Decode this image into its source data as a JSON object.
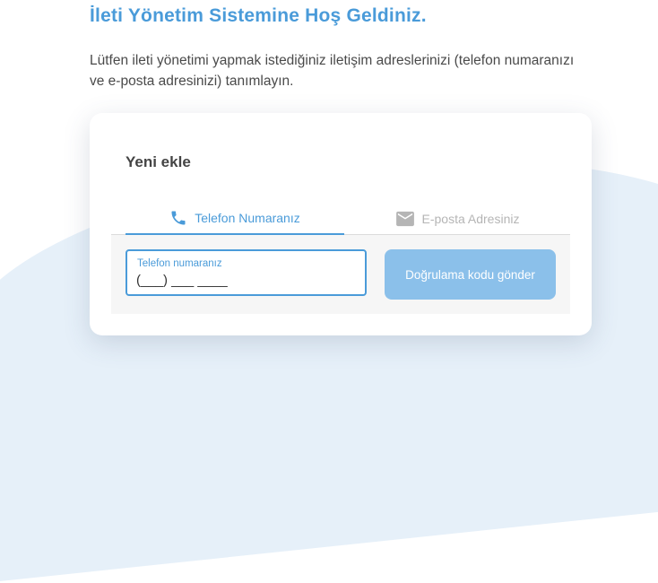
{
  "page": {
    "title": "İleti Yönetim Sistemine Hoş Geldiniz.",
    "intro": "Lütfen ileti yönetimi yapmak istediğiniz iletişim adreslerinizi (telefon numaranızı ve e-posta adresinizi) tanımlayın."
  },
  "card": {
    "title": "Yeni ekle",
    "tabs": [
      {
        "label": "Telefon Numaranız",
        "icon": "phone-icon",
        "active": true
      },
      {
        "label": "E-posta Adresiniz",
        "icon": "mail-icon",
        "active": false
      }
    ],
    "phone_field": {
      "label": "Telefon numaranız",
      "value": "(___) ___ ____"
    },
    "send_button": "Doğrulama kodu gönder"
  },
  "colors": {
    "accent": "#4a9bd9",
    "button": "#8bc0ea",
    "inactive": "#b5b5b5"
  }
}
